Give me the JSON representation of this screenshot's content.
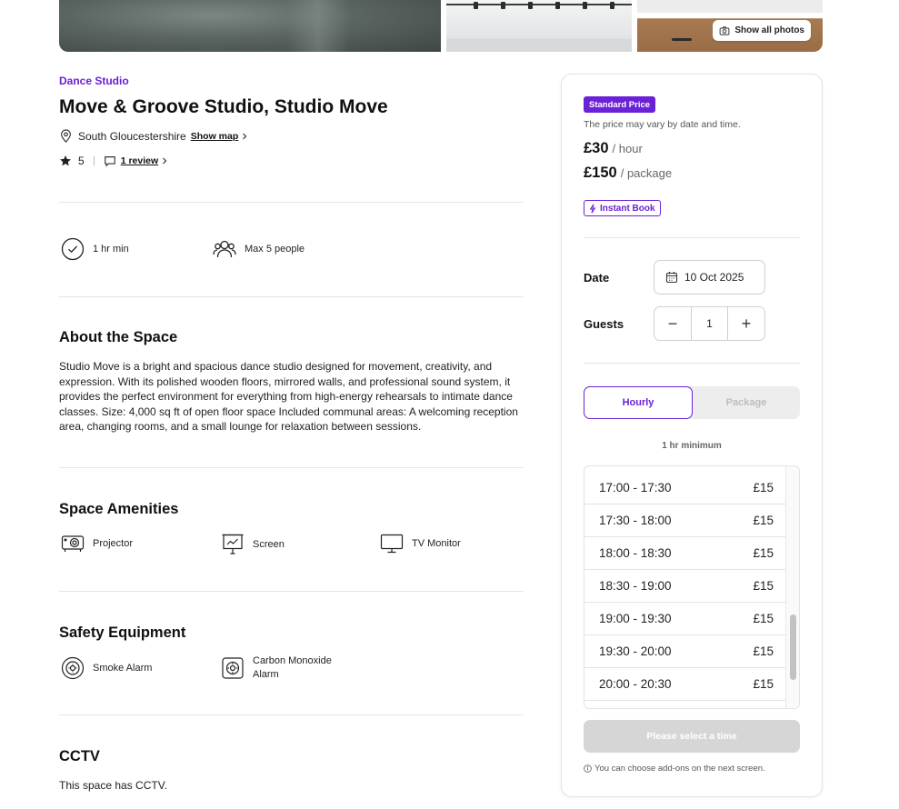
{
  "photos": {
    "show_all_label": "Show all photos"
  },
  "listing": {
    "category": "Dance Studio",
    "title": "Move & Groove Studio, Studio Move",
    "location": "South Gloucestershire",
    "show_map": "Show map",
    "rating": "5",
    "reviews": "1 review"
  },
  "features": [
    {
      "label": "1 hr min",
      "icon": "check-circle-icon"
    },
    {
      "label": "Max 5 people",
      "icon": "people-icon"
    }
  ],
  "about": {
    "heading": "About the Space",
    "text": "Studio Move is a bright and spacious dance studio designed for movement, creativity, and expression. With its polished wooden floors, mirrored walls, and professional sound system, it provides the perfect environment for everything from high-energy rehearsals to intimate dance classes. Size: 4,000 sq ft of open floor space Included communal areas: A welcoming reception area, changing rooms, and a small lounge for relaxation between sessions."
  },
  "amenities": {
    "heading": "Space Amenities",
    "items": [
      {
        "label": "Projector",
        "icon": "projector-icon"
      },
      {
        "label": "Screen",
        "icon": "screen-icon"
      },
      {
        "label": "TV Monitor",
        "icon": "tv-monitor-icon"
      }
    ]
  },
  "safety": {
    "heading": "Safety Equipment",
    "items": [
      {
        "label": "Smoke Alarm",
        "icon": "smoke-alarm-icon"
      },
      {
        "label_line1": "Carbon Monoxide",
        "label_line2": "Alarm",
        "icon": "co-alarm-icon"
      }
    ]
  },
  "cctv": {
    "heading": "CCTV",
    "text": "This space has CCTV."
  },
  "booking": {
    "badge": "Standard Price",
    "vary_note": "The price may vary by date and time.",
    "hour_price": "£30",
    "hour_unit": "/ hour",
    "package_price": "£150",
    "package_unit": "/ package",
    "instant_book": "Instant Book",
    "date_label": "Date",
    "date_value": "10 Oct 2025",
    "guests_label": "Guests",
    "guests_value": "1",
    "minus": "−",
    "plus": "+",
    "tab_hourly": "Hourly",
    "tab_package": "Package",
    "minimum_note": "1 hr minimum",
    "slots": [
      {
        "time": "17:00 - 17:30",
        "price": "£15"
      },
      {
        "time": "17:30 - 18:00",
        "price": "£15"
      },
      {
        "time": "18:00 - 18:30",
        "price": "£15"
      },
      {
        "time": "18:30 - 19:00",
        "price": "£15"
      },
      {
        "time": "19:00 - 19:30",
        "price": "£15"
      },
      {
        "time": "19:30 - 20:00",
        "price": "£15"
      },
      {
        "time": "20:00 - 20:30",
        "price": "£15"
      }
    ],
    "select_button": "Please select a time",
    "addons_note": "You can choose add-ons on the next screen.",
    "accent_color": "#6b21d6"
  }
}
